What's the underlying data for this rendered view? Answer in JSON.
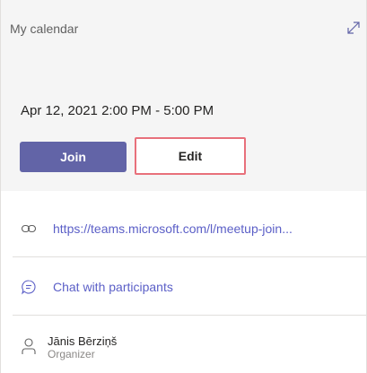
{
  "calendar": {
    "name": "My calendar",
    "expand_icon": "expand-icon"
  },
  "meeting": {
    "time": "Apr 12, 2021 2:00 PM - 5:00 PM"
  },
  "actions": {
    "join_label": "Join",
    "edit_label": "Edit",
    "join_color": "#6264a7",
    "highlight_color": "#e8707b"
  },
  "details": {
    "link_text": "https://teams.microsoft.com/l/meetup-join...",
    "link_icon": "link-icon",
    "chat_text": "Chat with participants",
    "chat_icon": "chat-icon",
    "accent_color": "#5b5fc7"
  },
  "organizer": {
    "name": "Jānis Bērziņš",
    "role": "Organizer",
    "icon": "person-icon"
  }
}
